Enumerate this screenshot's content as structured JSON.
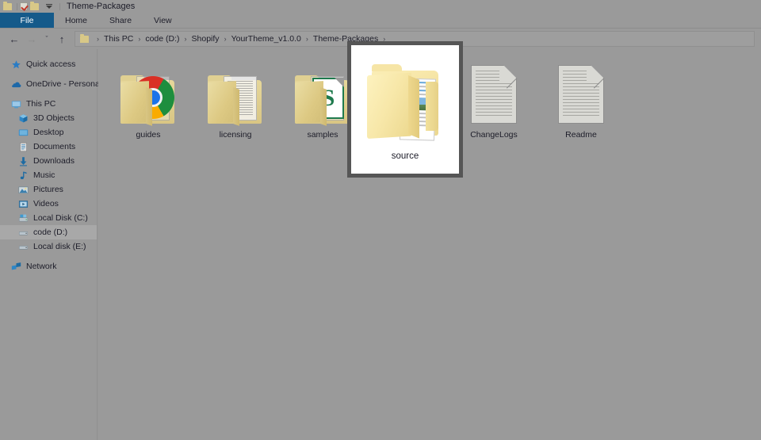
{
  "window": {
    "title": "Theme-Packages",
    "quick_access": [
      {
        "name": "folder-icon",
        "label": "Folder"
      },
      {
        "name": "properties-icon",
        "label": "Properties"
      },
      {
        "name": "new-folder-icon",
        "label": "New folder"
      },
      {
        "name": "customize-dropdown-icon",
        "label": "Customize Quick Access Toolbar"
      }
    ]
  },
  "ribbon": {
    "tabs": [
      {
        "label": "File",
        "active": true
      },
      {
        "label": "Home",
        "active": false
      },
      {
        "label": "Share",
        "active": false
      },
      {
        "label": "View",
        "active": false
      }
    ]
  },
  "navbar": {
    "back_icon": "←",
    "forward_icon": "→",
    "recent_icon": "ˇ",
    "up_icon": "↑",
    "breadcrumbs": [
      "This PC",
      "code (D:)",
      "Shopify",
      "YourTheme_v1.0.0",
      "Theme-Packages"
    ],
    "separator": "›",
    "trailing_separator": "›"
  },
  "sidebar": {
    "items": [
      {
        "label": "Quick access",
        "icon": "star-icon",
        "indent": false,
        "selected": false
      },
      {
        "label": "OneDrive - Personal",
        "icon": "cloud-icon",
        "indent": false,
        "selected": false
      },
      {
        "label": "This PC",
        "icon": "monitor-icon",
        "indent": false,
        "selected": false
      },
      {
        "label": "3D Objects",
        "icon": "cube-icon",
        "indent": true,
        "selected": false
      },
      {
        "label": "Desktop",
        "icon": "desktop-icon",
        "indent": true,
        "selected": false
      },
      {
        "label": "Documents",
        "icon": "documents-icon",
        "indent": true,
        "selected": false
      },
      {
        "label": "Downloads",
        "icon": "downloads-icon",
        "indent": true,
        "selected": false
      },
      {
        "label": "Music",
        "icon": "music-icon",
        "indent": true,
        "selected": false
      },
      {
        "label": "Pictures",
        "icon": "pictures-icon",
        "indent": true,
        "selected": false
      },
      {
        "label": "Videos",
        "icon": "videos-icon",
        "indent": true,
        "selected": false
      },
      {
        "label": "Local Disk (C:)",
        "icon": "system-drive-icon",
        "indent": true,
        "selected": false
      },
      {
        "label": "code (D:)",
        "icon": "drive-icon",
        "indent": true,
        "selected": true
      },
      {
        "label": "Local disk (E:)",
        "icon": "drive-icon",
        "indent": true,
        "selected": false
      },
      {
        "label": "Network",
        "icon": "network-icon",
        "indent": false,
        "selected": false
      }
    ]
  },
  "files": [
    {
      "name": "guides",
      "type": "folder",
      "preview": "chrome",
      "selected": false
    },
    {
      "name": "licensing",
      "type": "folder",
      "preview": "document",
      "selected": false
    },
    {
      "name": "samples",
      "type": "folder",
      "preview": "green-file",
      "selected": false
    },
    {
      "name": "source",
      "type": "folder",
      "preview": "papers",
      "selected": true
    },
    {
      "name": "ChangeLogs",
      "type": "file",
      "preview": "text-document",
      "selected": false
    },
    {
      "name": "Readme",
      "type": "file",
      "preview": "text-document",
      "selected": false
    }
  ],
  "colors": {
    "window_background": "#9a9a9a",
    "file_tab_accent": "#155a8a",
    "selection_border": "#565656",
    "selection_background": "#ffffff",
    "sidebar_selected": "#a8a8a8",
    "folder_yellow": "#f0dc9a"
  }
}
